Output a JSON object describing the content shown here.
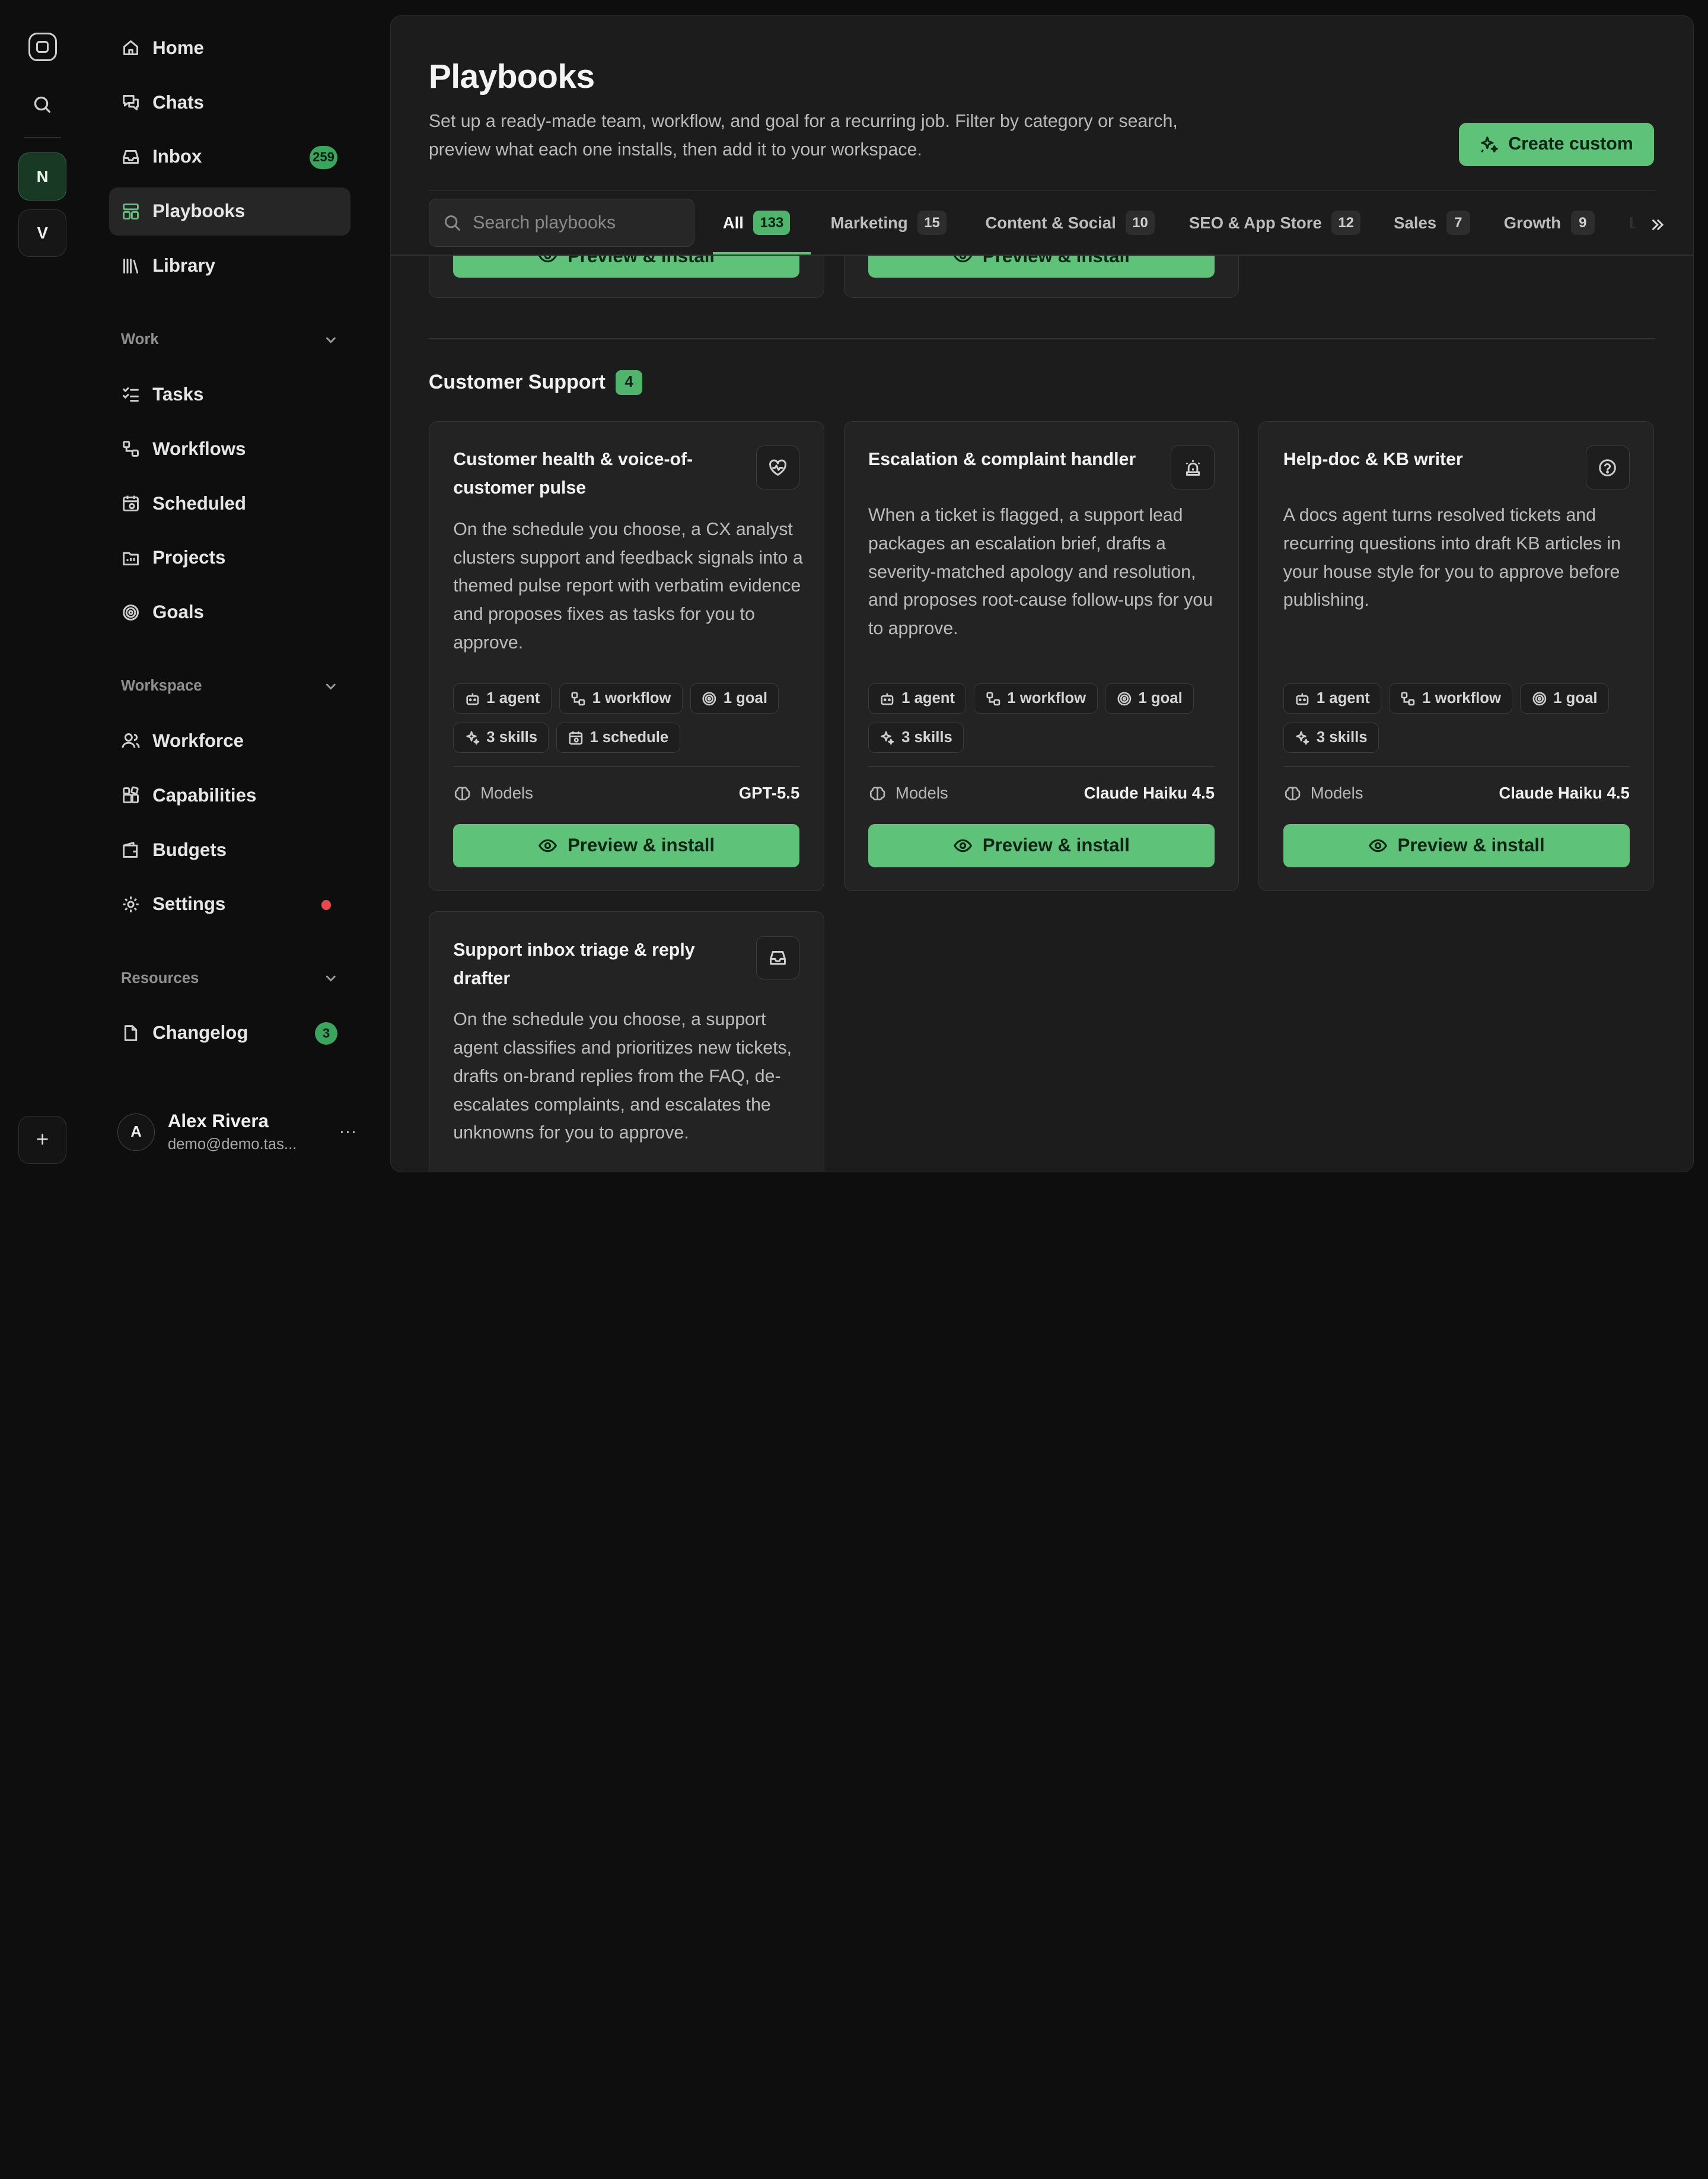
{
  "rail": {
    "workspaces": [
      "N",
      "V"
    ],
    "add_label": "+"
  },
  "sidebar": {
    "primary": [
      {
        "label": "Home",
        "icon": "home-icon"
      },
      {
        "label": "Chats",
        "icon": "chat-icon"
      },
      {
        "label": "Inbox",
        "icon": "inbox-icon",
        "badge": "259"
      },
      {
        "label": "Playbooks",
        "icon": "playbooks-icon",
        "active": true
      },
      {
        "label": "Library",
        "icon": "library-icon"
      }
    ],
    "work_label": "Work",
    "work": [
      {
        "label": "Tasks",
        "icon": "tasks-icon"
      },
      {
        "label": "Workflows",
        "icon": "workflow-icon"
      },
      {
        "label": "Scheduled",
        "icon": "calendar-icon"
      },
      {
        "label": "Projects",
        "icon": "projects-icon"
      },
      {
        "label": "Goals",
        "icon": "target-icon"
      }
    ],
    "workspace_label": "Workspace",
    "workspace": [
      {
        "label": "Workforce",
        "icon": "users-icon"
      },
      {
        "label": "Capabilities",
        "icon": "capabilities-icon"
      },
      {
        "label": "Budgets",
        "icon": "wallet-icon"
      },
      {
        "label": "Settings",
        "icon": "gear-icon"
      }
    ],
    "resources_label": "Resources",
    "resources": [
      {
        "label": "Changelog",
        "icon": "file-icon",
        "badge": "3"
      }
    ],
    "user": {
      "initial": "A",
      "name": "Alex Rivera",
      "email": "demo@demo.tas...",
      "more": "..."
    }
  },
  "page": {
    "title": "Playbooks",
    "description": "Set up a ready-made team, workflow, and goal for a recurring job. Filter by category or search, preview what each one installs, then add it to your workspace.",
    "create_label": "Create custom",
    "search_placeholder": "Search playbooks"
  },
  "tabs": [
    {
      "label": "All",
      "count": "133",
      "active": true
    },
    {
      "label": "Marketing",
      "count": "15"
    },
    {
      "label": "Content & Social",
      "count": "10"
    },
    {
      "label": "SEO & App Store",
      "count": "12"
    },
    {
      "label": "Sales",
      "count": "7"
    },
    {
      "label": "Growth",
      "count": "9"
    }
  ],
  "tabs_overflow": "L",
  "section": {
    "title": "Customer Support",
    "count": "4"
  },
  "install_label": "Preview & install",
  "models_label": "Models",
  "cards": [
    {
      "title": "Customer health & voice-of-customer pulse",
      "icon": "heart-pulse-icon",
      "description": "On the schedule you choose, a CX analyst clusters support and feedback signals into a themed pulse report with verbatim evidence and proposes fixes as tasks for you to approve.",
      "chips": [
        "1 agent",
        "1 workflow",
        "1 goal",
        "3 skills",
        "1 schedule"
      ],
      "model": "GPT-5.5"
    },
    {
      "title": "Escalation & complaint handler",
      "icon": "siren-icon",
      "description": "When a ticket is flagged, a support lead packages an escalation brief, drafts a severity-matched apology and resolution, and proposes root-cause follow-ups for you to approve.",
      "chips": [
        "1 agent",
        "1 workflow",
        "1 goal",
        "3 skills"
      ],
      "model": "Claude Haiku 4.5"
    },
    {
      "title": "Help-doc & KB writer",
      "icon": "help-circle-icon",
      "description": "A docs agent turns resolved tickets and recurring questions into draft KB articles in your house style for you to approve before publishing.",
      "chips": [
        "1 agent",
        "1 workflow",
        "1 goal",
        "3 skills"
      ],
      "model": "Claude Haiku 4.5"
    },
    {
      "title": "Support inbox triage & reply drafter",
      "icon": "inbox-icon",
      "description": "On the schedule you choose, a support agent classifies and prioritizes new tickets, drafts on-brand replies from the FAQ, de-escalates complaints, and escalates the unknowns for you to approve."
    }
  ]
}
